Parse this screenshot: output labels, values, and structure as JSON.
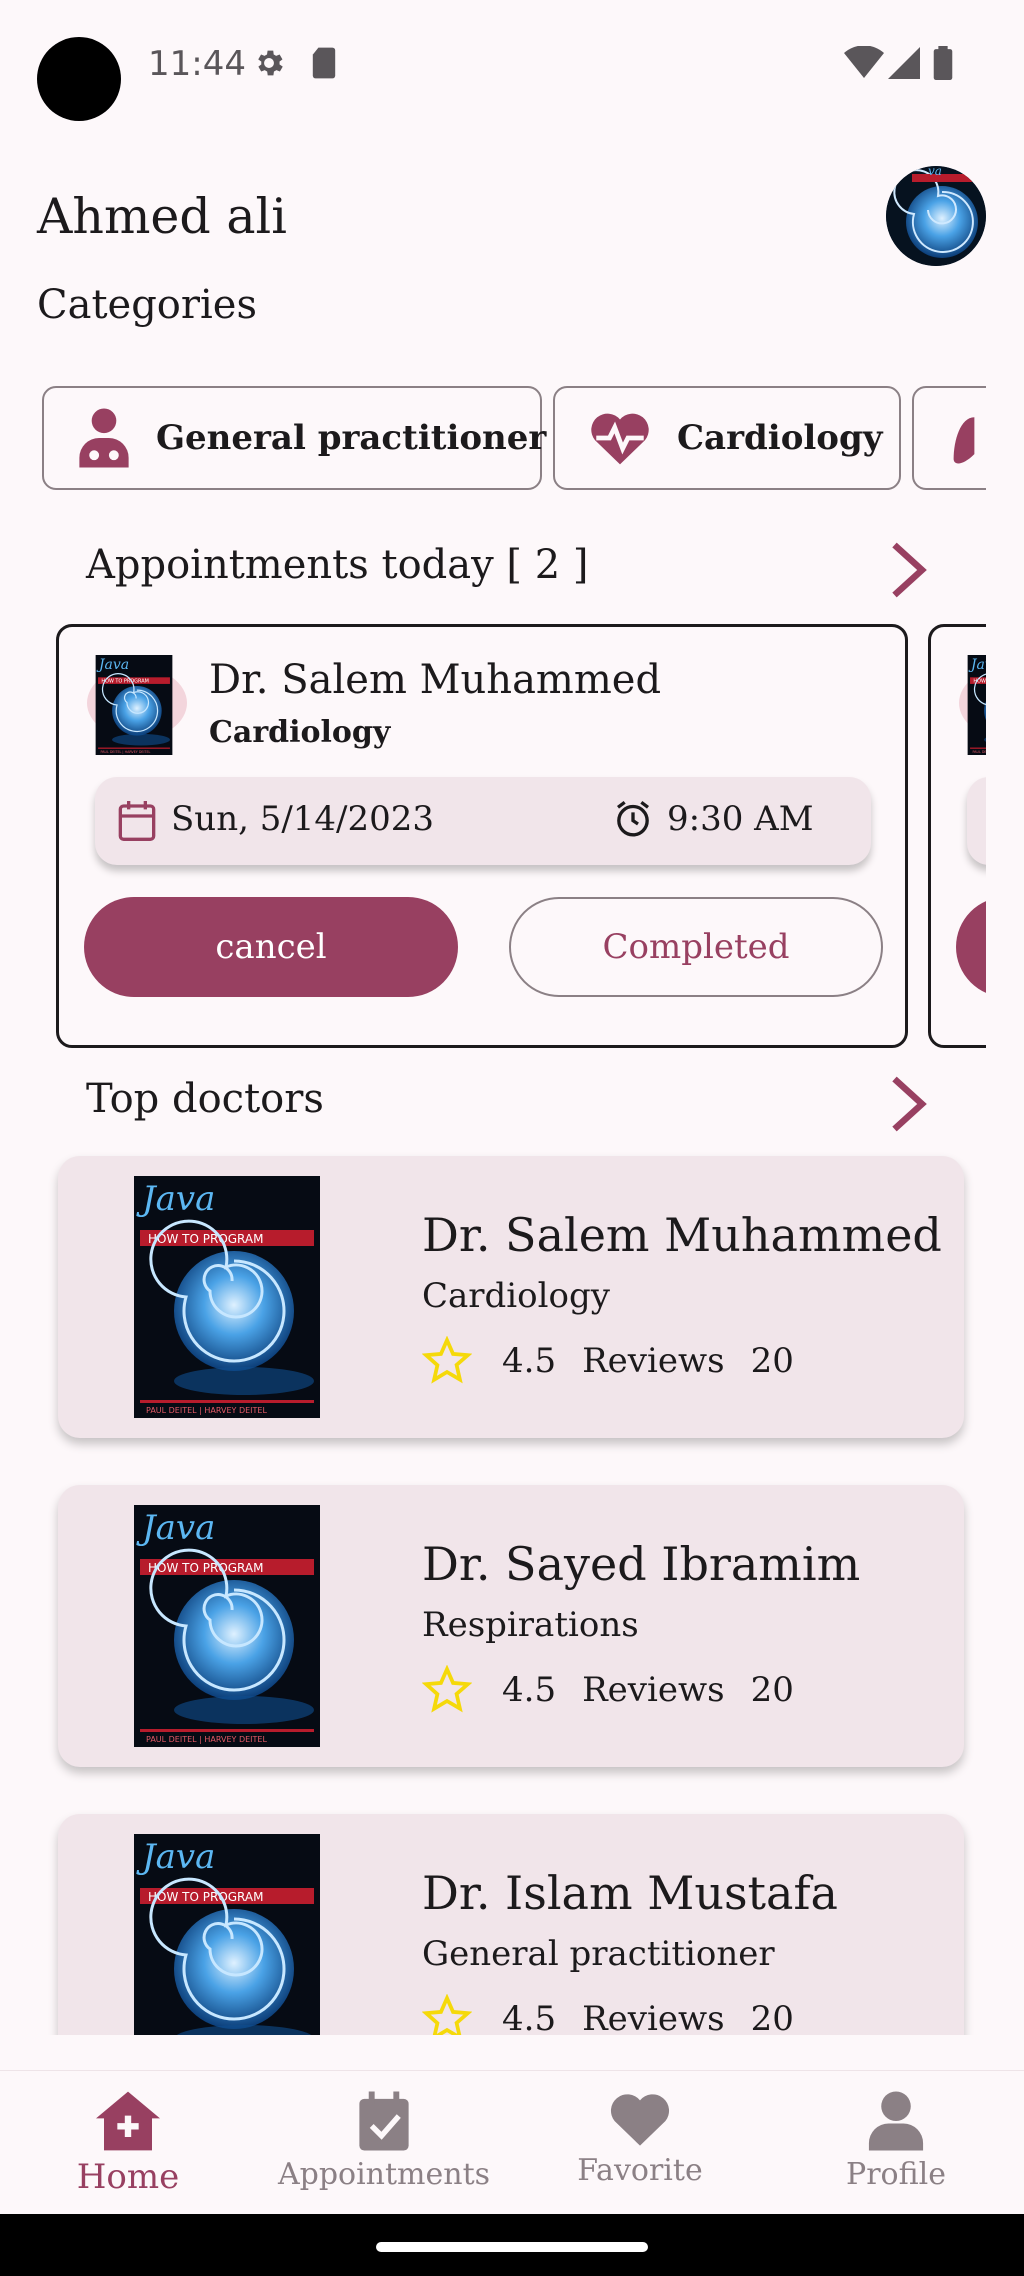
{
  "status_bar": {
    "time": "11:44"
  },
  "header": {
    "user_name": "Ahmed ali"
  },
  "categories": {
    "title": "Categories",
    "items": [
      {
        "label": "General practitioner",
        "icon": "doctor-icon"
      },
      {
        "label": "Cardiology",
        "icon": "heart-pulse-icon"
      },
      {
        "label": "",
        "icon": "lungs-icon"
      }
    ]
  },
  "appointments": {
    "title": "Appointments today [ 2 ]",
    "cards": [
      {
        "doctor": "Dr. Salem Muhammed",
        "specialty": "Cardiology",
        "date": "Sun, 5/14/2023",
        "time": "9:30 AM",
        "cancel_label": "cancel",
        "completed_label": "Completed"
      }
    ]
  },
  "top_doctors": {
    "title": "Top doctors",
    "items": [
      {
        "name": "Dr. Salem Muhammed",
        "specialty": "Cardiology",
        "rating": "4.5",
        "reviews_label": "Reviews",
        "reviews": "20"
      },
      {
        "name": "Dr. Sayed Ibramim",
        "specialty": "Respirations",
        "rating": "4.5",
        "reviews_label": "Reviews",
        "reviews": "20"
      },
      {
        "name": "Dr. Islam Mustafa",
        "specialty": "General practitioner",
        "rating": "4.5",
        "reviews_label": "Reviews",
        "reviews": "20"
      }
    ]
  },
  "bottom_nav": {
    "items": [
      {
        "label": "Home",
        "icon": "home-icon",
        "active": true
      },
      {
        "label": "Appointments",
        "icon": "calendar-check-icon",
        "active": false
      },
      {
        "label": "Favorite",
        "icon": "heart-icon",
        "active": false
      },
      {
        "label": "Profile",
        "icon": "person-icon",
        "active": false
      }
    ]
  },
  "colors": {
    "accent": "#984061",
    "card_bg": "#f1e5ea",
    "background": "#fdf8fa",
    "star": "#f5d90a"
  },
  "book_cover": {
    "brand": "Java",
    "subtitle": "HOW TO PROGRAM"
  }
}
